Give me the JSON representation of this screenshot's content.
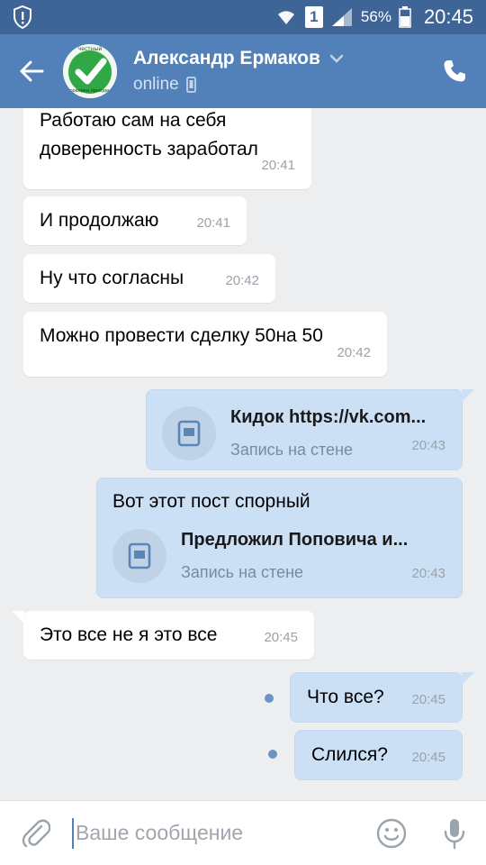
{
  "status_bar": {
    "battery": "56%",
    "time": "20:45",
    "sim_badge": "1",
    "icons": [
      "shield-alert-icon",
      "wifi-icon",
      "signal-icon",
      "battery-icon"
    ]
  },
  "header": {
    "contact_name": "Александр Ермаков",
    "status": "online",
    "avatar_icon": "checkmark-avatar",
    "avatar_caption_top": "честный",
    "avatar_caption_bottom": "Проверка пройдена",
    "colors": {
      "bar": "#5181b8",
      "status_bar": "#3f6596"
    }
  },
  "messages": [
    {
      "direction": "in",
      "text": "Работаю сам на себя\nдоверенность заработал",
      "time": "20:41"
    },
    {
      "direction": "in",
      "text": "И продолжаю",
      "time": "20:41"
    },
    {
      "direction": "in",
      "text": "Ну что согласны",
      "time": "20:42"
    },
    {
      "direction": "in",
      "text": "Можно провести сделку 50на 50",
      "time": "20:42"
    },
    {
      "direction": "out",
      "attachment": {
        "title": "Кидок https://vk.com...",
        "subtitle": "Запись на стене"
      },
      "time": "20:43"
    },
    {
      "direction": "out",
      "text": "Вот этот пост спорный",
      "attachment": {
        "title": "Предложил Поповича и...",
        "subtitle": "Запись на стене"
      },
      "time": "20:43"
    },
    {
      "direction": "in",
      "text": "Это все не я это все",
      "time": "20:45"
    },
    {
      "direction": "out",
      "text": "Что все?",
      "time": "20:45",
      "unread": true
    },
    {
      "direction": "out",
      "text": "Слился?",
      "time": "20:45",
      "unread": true
    }
  ],
  "input": {
    "placeholder": "Ваше сообщение",
    "value": ""
  },
  "colors": {
    "bubble_out": "#cce0f5",
    "bubble_in": "#ffffff",
    "background": "#edeef0"
  }
}
